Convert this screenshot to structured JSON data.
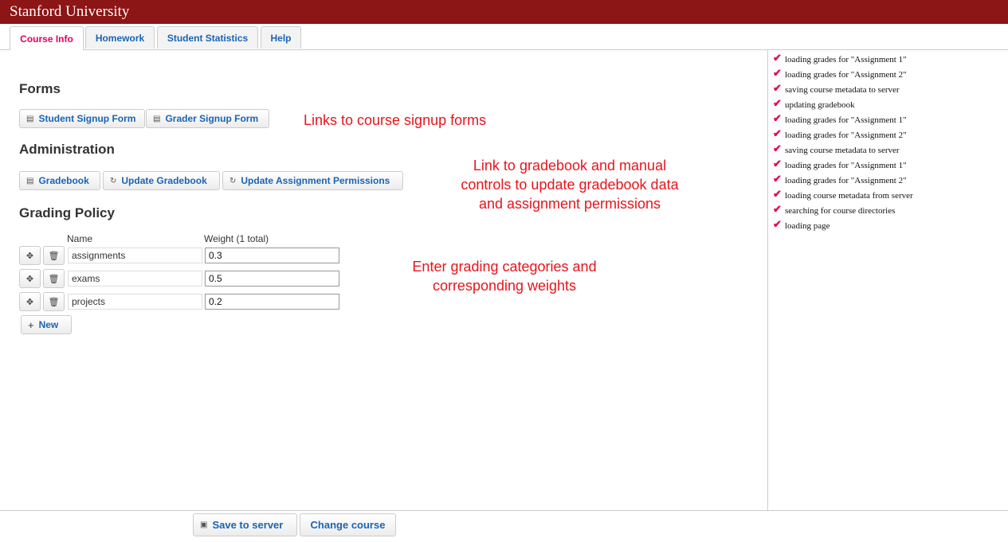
{
  "header": {
    "brand": "Stanford University"
  },
  "tabs": [
    {
      "label": "Course Info",
      "active": true
    },
    {
      "label": "Homework",
      "active": false
    },
    {
      "label": "Student Statistics",
      "active": false
    },
    {
      "label": "Help",
      "active": false
    }
  ],
  "forms": {
    "heading": "Forms",
    "student_signup": "Student Signup Form",
    "grader_signup": "Grader Signup Form"
  },
  "administration": {
    "heading": "Administration",
    "gradebook": "Gradebook",
    "update_gradebook": "Update Gradebook",
    "update_permissions": "Update Assignment Permissions"
  },
  "grading_policy": {
    "heading": "Grading Policy",
    "col_name": "Name",
    "col_weight": "Weight (1 total)",
    "rows": [
      {
        "name": "assignments",
        "weight": "0.3"
      },
      {
        "name": "exams",
        "weight": "0.5"
      },
      {
        "name": "projects",
        "weight": "0.2"
      }
    ],
    "new_label": "New"
  },
  "annotations": {
    "forms": "Links to course signup forms",
    "admin_line1": "Link to gradebook and manual",
    "admin_line2": "controls to update gradebook data",
    "admin_line3": "and assignment permissions",
    "grading_line1": "Enter grading categories and",
    "grading_line2": "corresponding weights"
  },
  "log": [
    "loading grades for \"Assignment 1\"",
    "loading grades for \"Assignment 2\"",
    "saving course metadata to server",
    "updating gradebook",
    "loading grades for \"Assignment 1\"",
    "loading grades for \"Assignment 2\"",
    "saving course metadata to server",
    "loading grades for \"Assignment 1\"",
    "loading grades for \"Assignment 2\"",
    "loading course metadata from server",
    "searching for course directories",
    "loading page"
  ],
  "footer": {
    "save_label": "Save to server",
    "change_course_label": "Change course"
  },
  "colors": {
    "brand": "#8c1515",
    "active_tab": "#e5005b",
    "link": "#1a64b4",
    "annotation": "#e8141b"
  }
}
